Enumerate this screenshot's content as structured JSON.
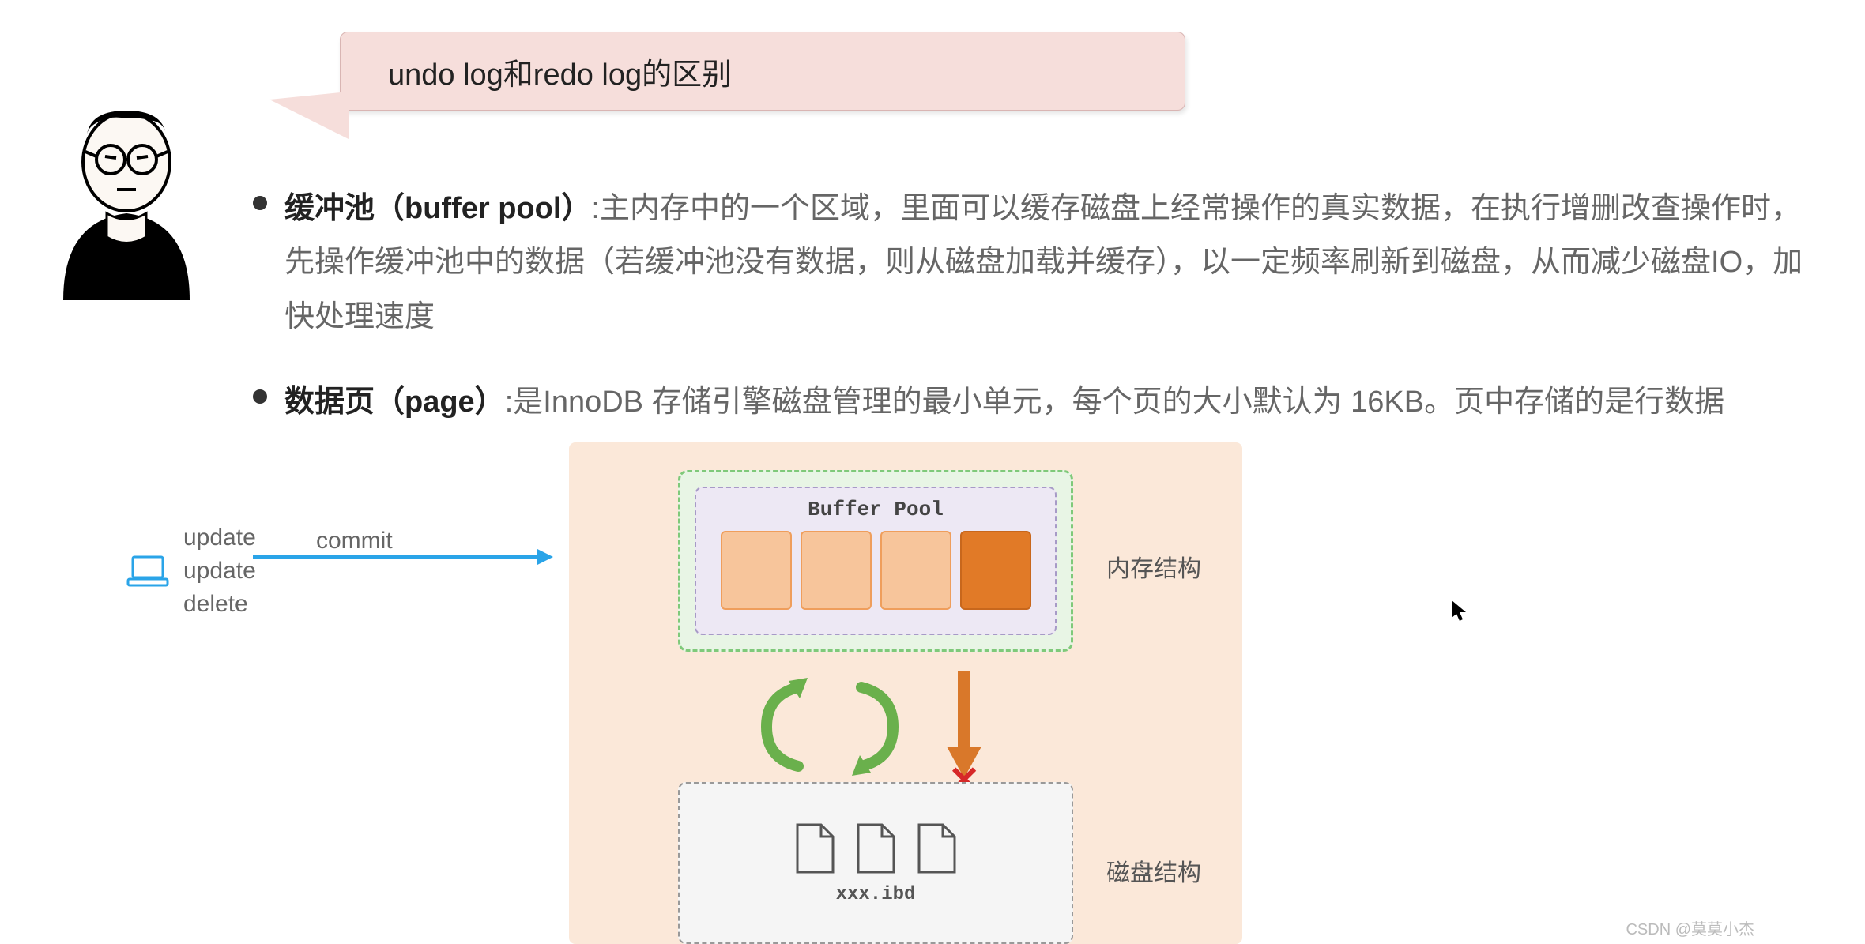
{
  "title": "undo log和redo log的区别",
  "bullets": [
    {
      "label": "缓冲池（buffer pool）",
      "text": ":主内存中的一个区域，里面可以缓存磁盘上经常操作的真实数据，在执行增删改查操作时，先操作缓冲池中的数据（若缓冲池没有数据，则从磁盘加载并缓存），以一定频率刷新到磁盘，从而减少磁盘IO，加快处理速度"
    },
    {
      "label": "数据页（page）",
      "text": ":是InnoDB 存储引擎磁盘管理的最小单元，每个页的大小默认为 16KB。页中存储的是行数据"
    }
  ],
  "ops": {
    "line1": "update",
    "line2": "update",
    "line3": "delete"
  },
  "commit": "commit",
  "buffer_pool_title": "Buffer Pool",
  "mem_label": "内存结构",
  "disk_label": "磁盘结构",
  "ibd_name": "xxx.ibd",
  "watermark": "CSDN @莫莫小杰"
}
